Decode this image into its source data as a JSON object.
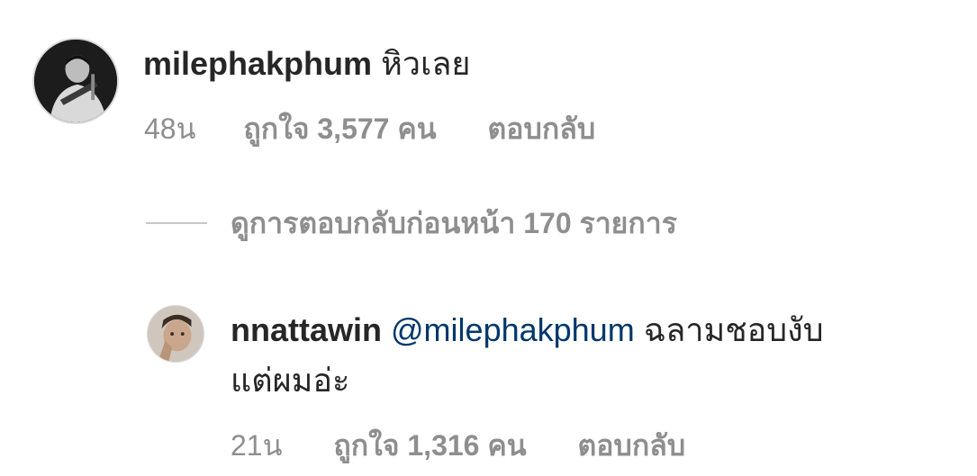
{
  "comment": {
    "username": "milephakphum",
    "text": "หิวเลย",
    "time": "48น",
    "likes": "ถูกใจ 3,577 คน",
    "reply_label": "ตอบกลับ"
  },
  "view_replies": {
    "label": "ดูการตอบกลับก่อนหน้า 170 รายการ"
  },
  "reply": {
    "username": "nnattawin",
    "mention": "@milephakphum",
    "text_line1": "ฉลามชอบงับ",
    "text_line2": "แต่ผมอ่ะ",
    "time": "21น",
    "likes": "ถูกใจ 1,316 คน",
    "reply_label": "ตอบกลับ"
  },
  "colors": {
    "text": "#262626",
    "secondary": "#8e8e8e",
    "mention": "#00376b"
  }
}
